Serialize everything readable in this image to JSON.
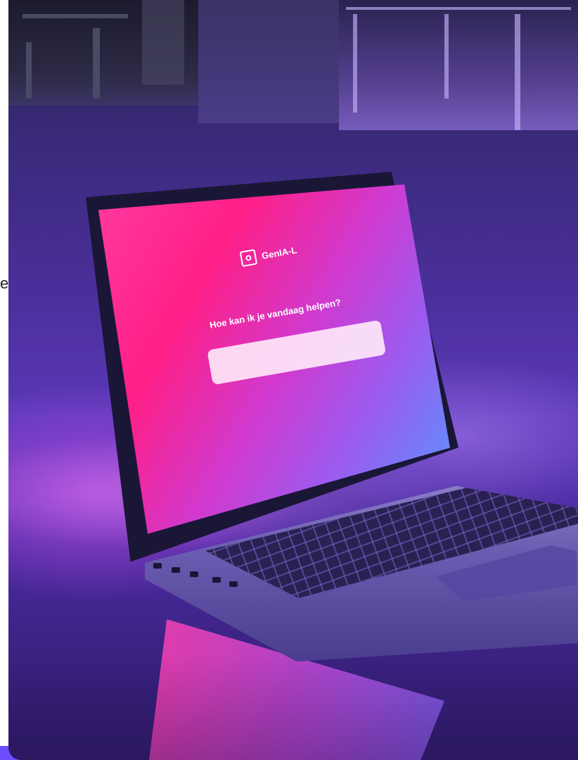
{
  "photo": {
    "app_name": "GenIA-L",
    "prompt": "Hoe kan ik je vandaag helpen?",
    "input_value": ""
  },
  "edge_fragment": "e",
  "icons": {
    "app_logo": "app-logo-icon"
  },
  "colors": {
    "screen_pink": "#ff1f86",
    "screen_blue": "#4aa0ff",
    "ambient_purple": "#5a38b8",
    "accent": "#6b4dff"
  }
}
